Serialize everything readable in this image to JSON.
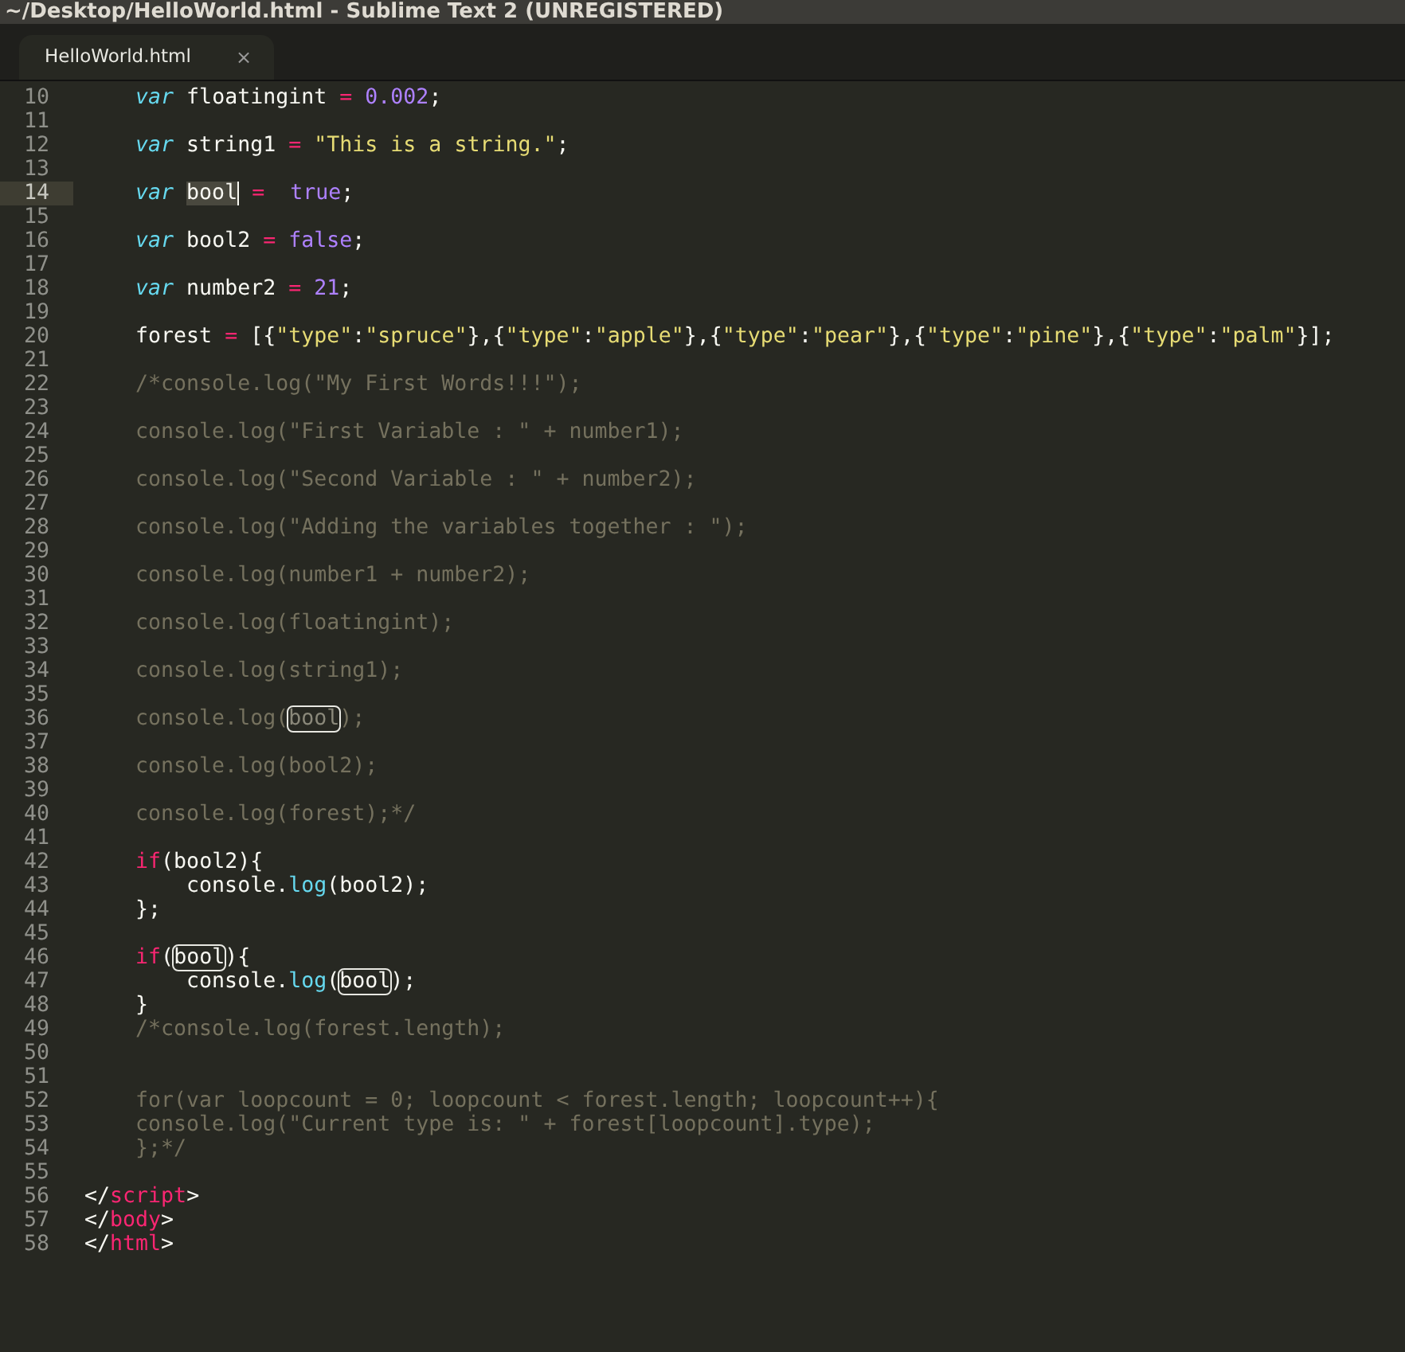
{
  "window": {
    "title": "~/Desktop/HelloWorld.html - Sublime Text 2 (UNREGISTERED)"
  },
  "tabs": [
    {
      "label": "HelloWorld.html",
      "close": "×",
      "selected": true
    }
  ],
  "editor": {
    "lines": [
      {
        "n": "10",
        "current": false,
        "tokens": [
          {
            "text": "    var",
            "kind": "keyword"
          },
          {
            "text": " floatingint ",
            "kind": "plain"
          },
          {
            "text": "=",
            "kind": "operator"
          },
          {
            "text": " 0.002",
            "kind": "number"
          },
          {
            "text": ";",
            "kind": "plain"
          }
        ]
      },
      {
        "n": "11",
        "current": false
      },
      {
        "n": "12",
        "current": false,
        "tokens": [
          {
            "text": "    var",
            "kind": "keyword"
          },
          {
            "text": " string1 ",
            "kind": "plain"
          },
          {
            "text": "=",
            "kind": "operator"
          },
          {
            "text": " \"This is a string.\"",
            "kind": "string"
          },
          {
            "text": ";",
            "kind": "plain"
          }
        ]
      },
      {
        "n": "13",
        "current": false
      },
      {
        "n": "14",
        "current": true,
        "tokens": [
          {
            "text": "    var ",
            "kind": "keyword"
          },
          {
            "text": "bool",
            "kind": "selection"
          },
          {
            "text": " =",
            "kind": "operator"
          },
          {
            "text": "  true",
            "kind": "number"
          },
          {
            "text": ";",
            "kind": "plain"
          }
        ]
      },
      {
        "n": "15",
        "current": false
      },
      {
        "n": "16",
        "current": false,
        "tokens": [
          {
            "text": "    var",
            "kind": "keyword"
          },
          {
            "text": " bool2 ",
            "kind": "plain"
          },
          {
            "text": "=",
            "kind": "operator"
          },
          {
            "text": " false",
            "kind": "number"
          },
          {
            "text": ";",
            "kind": "plain"
          }
        ]
      },
      {
        "n": "17",
        "current": false
      },
      {
        "n": "18",
        "current": false,
        "tokens": [
          {
            "text": "    var",
            "kind": "keyword"
          },
          {
            "text": " number2 ",
            "kind": "plain"
          },
          {
            "text": "=",
            "kind": "operator"
          },
          {
            "text": " 21",
            "kind": "number"
          },
          {
            "text": ";",
            "kind": "plain"
          }
        ]
      },
      {
        "n": "19",
        "current": false
      },
      {
        "n": "20",
        "current": false,
        "tokens": [
          {
            "text": "    forest ",
            "kind": "plain"
          },
          {
            "text": "=",
            "kind": "operator"
          },
          {
            "text": " [{",
            "kind": "plain"
          },
          {
            "text": "\"type\"",
            "kind": "string"
          },
          {
            "text": ":",
            "kind": "plain"
          },
          {
            "text": "\"spruce\"",
            "kind": "string"
          },
          {
            "text": "},{",
            "kind": "plain"
          },
          {
            "text": "\"type\"",
            "kind": "string"
          },
          {
            "text": ":",
            "kind": "plain"
          },
          {
            "text": "\"apple\"",
            "kind": "string"
          },
          {
            "text": "},{",
            "kind": "plain"
          },
          {
            "text": "\"type\"",
            "kind": "string"
          },
          {
            "text": ":",
            "kind": "plain"
          },
          {
            "text": "\"pear\"",
            "kind": "string"
          },
          {
            "text": "},{",
            "kind": "plain"
          },
          {
            "text": "\"type\"",
            "kind": "string"
          },
          {
            "text": ":",
            "kind": "plain"
          },
          {
            "text": "\"pine\"",
            "kind": "string"
          },
          {
            "text": "},{",
            "kind": "plain"
          },
          {
            "text": "\"type\"",
            "kind": "string"
          },
          {
            "text": ":",
            "kind": "plain"
          },
          {
            "text": "\"palm\"",
            "kind": "string"
          },
          {
            "text": "}];",
            "kind": "plain"
          }
        ]
      },
      {
        "n": "21",
        "current": false
      },
      {
        "n": "22",
        "current": false,
        "tokens": [
          {
            "text": "    /*console.log(\"My First Words!!!\");",
            "kind": "comment"
          }
        ]
      },
      {
        "n": "23",
        "current": false
      },
      {
        "n": "24",
        "current": false,
        "tokens": [
          {
            "text": "    console.log(\"First Variable : \" + number1);",
            "kind": "comment"
          }
        ]
      },
      {
        "n": "25",
        "current": false
      },
      {
        "n": "26",
        "current": false,
        "tokens": [
          {
            "text": "    console.log(\"Second Variable : \" + number2);",
            "kind": "comment"
          }
        ]
      },
      {
        "n": "27",
        "current": false
      },
      {
        "n": "28",
        "current": false,
        "tokens": [
          {
            "text": "    console.log(\"Adding the variables together : \");",
            "kind": "comment"
          }
        ]
      },
      {
        "n": "29",
        "current": false
      },
      {
        "n": "30",
        "current": false,
        "tokens": [
          {
            "text": "    console.log(number1 + number2);",
            "kind": "comment"
          }
        ]
      },
      {
        "n": "31",
        "current": false
      },
      {
        "n": "32",
        "current": false,
        "tokens": [
          {
            "text": "    console.log(floatingint);",
            "kind": "comment"
          }
        ]
      },
      {
        "n": "33",
        "current": false
      },
      {
        "n": "34",
        "current": false,
        "tokens": [
          {
            "text": "    console.log(string1);",
            "kind": "comment"
          }
        ]
      },
      {
        "n": "35",
        "current": false
      },
      {
        "n": "36",
        "current": false,
        "tokens": [
          {
            "text": "    console.log(",
            "kind": "comment"
          },
          {
            "text": "bool",
            "kind": "comment-match"
          },
          {
            "text": ");",
            "kind": "comment"
          }
        ]
      },
      {
        "n": "37",
        "current": false
      },
      {
        "n": "38",
        "current": false,
        "tokens": [
          {
            "text": "    console.log(bool2);",
            "kind": "comment"
          }
        ]
      },
      {
        "n": "39",
        "current": false
      },
      {
        "n": "40",
        "current": false,
        "tokens": [
          {
            "text": "    console.log(forest);*/",
            "kind": "comment"
          }
        ]
      },
      {
        "n": "41",
        "current": false
      },
      {
        "n": "42",
        "current": false,
        "tokens": [
          {
            "text": "    if",
            "kind": "operator"
          },
          {
            "text": "(bool2){",
            "kind": "plain"
          }
        ]
      },
      {
        "n": "43",
        "current": false,
        "tokens": [
          {
            "text": "        console.",
            "kind": "plain"
          },
          {
            "text": "log",
            "kind": "function"
          },
          {
            "text": "(bool2);",
            "kind": "plain"
          }
        ]
      },
      {
        "n": "44",
        "current": false,
        "tokens": [
          {
            "text": "    };",
            "kind": "plain"
          }
        ]
      },
      {
        "n": "45",
        "current": false
      },
      {
        "n": "46",
        "current": false,
        "tokens": [
          {
            "text": "    if",
            "kind": "operator"
          },
          {
            "text": "(",
            "kind": "plain"
          },
          {
            "text": "bool",
            "kind": "match"
          },
          {
            "text": "){",
            "kind": "plain"
          }
        ]
      },
      {
        "n": "47",
        "current": false,
        "tokens": [
          {
            "text": "        console.",
            "kind": "plain"
          },
          {
            "text": "log",
            "kind": "function"
          },
          {
            "text": "(",
            "kind": "plain"
          },
          {
            "text": "bool",
            "kind": "match"
          },
          {
            "text": ");",
            "kind": "plain"
          }
        ]
      },
      {
        "n": "48",
        "current": false,
        "tokens": [
          {
            "text": "    }",
            "kind": "plain"
          }
        ]
      },
      {
        "n": "49",
        "current": false,
        "tokens": [
          {
            "text": "    /*console.log(forest.length);",
            "kind": "comment"
          }
        ]
      },
      {
        "n": "50",
        "current": false
      },
      {
        "n": "51",
        "current": false
      },
      {
        "n": "52",
        "current": false,
        "tokens": [
          {
            "text": "    for(var loopcount = 0; loopcount < forest.length; loopcount++){",
            "kind": "comment"
          }
        ]
      },
      {
        "n": "53",
        "current": false,
        "tokens": [
          {
            "text": "    console.log(\"Current type is: \" + forest[loopcount].type);",
            "kind": "comment"
          }
        ]
      },
      {
        "n": "54",
        "current": false,
        "tokens": [
          {
            "text": "    };*/",
            "kind": "comment"
          }
        ]
      },
      {
        "n": "55",
        "current": false
      },
      {
        "n": "56",
        "current": false,
        "tokens": [
          {
            "text": "</",
            "kind": "plain"
          },
          {
            "text": "script",
            "kind": "tag"
          },
          {
            "text": ">",
            "kind": "plain"
          }
        ]
      },
      {
        "n": "57",
        "current": false,
        "tokens": [
          {
            "text": "</",
            "kind": "plain"
          },
          {
            "text": "body",
            "kind": "tag"
          },
          {
            "text": ">",
            "kind": "plain"
          }
        ]
      },
      {
        "n": "58",
        "current": false,
        "tokens": [
          {
            "text": "</",
            "kind": "plain"
          },
          {
            "text": "html",
            "kind": "tag"
          },
          {
            "text": ">",
            "kind": "plain"
          }
        ]
      }
    ]
  }
}
